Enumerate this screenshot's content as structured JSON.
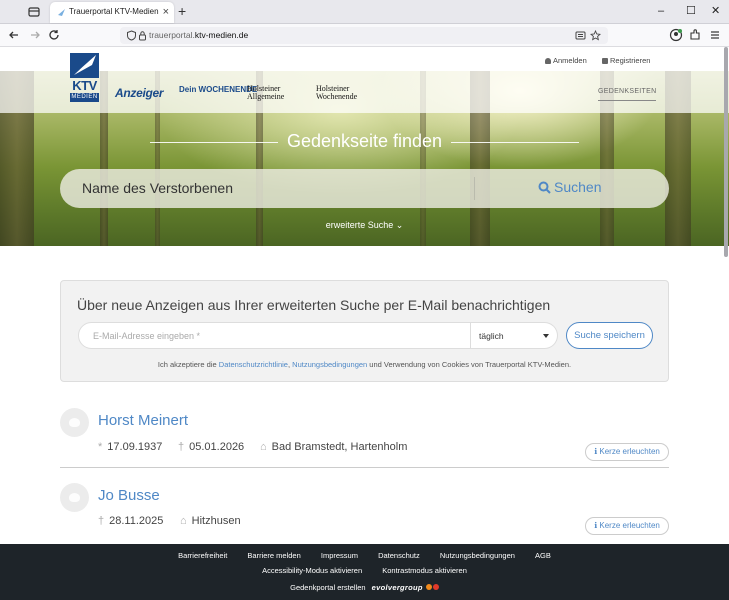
{
  "browser": {
    "tab_title": "Trauerportal KTV-Medien",
    "url_prefix": "trauerportal.",
    "url_domain": "ktv-medien.de"
  },
  "header": {
    "login": "Anmelden",
    "register": "Registrieren",
    "nav_gedenkseiten": "GEDENKSEITEN",
    "logo": {
      "letters": "KTV",
      "sub": "MEDIEN"
    },
    "papers": [
      "Anzeiger",
      "Dein WOCHENENDE",
      "Holsteiner Allgemeine",
      "Holsteiner Wochenende"
    ]
  },
  "hero": {
    "title": "Gedenkseite finden",
    "search_placeholder": "Name des Verstorbenen",
    "search_button": "Suchen",
    "advanced": "erweiterte Suche"
  },
  "notify": {
    "title": "Über neue Anzeigen aus Ihrer erweiterten Suche per E-Mail benachrichtigen",
    "email_placeholder": "E-Mail-Adresse eingeben *",
    "frequency": "täglich",
    "save": "Suche speichern",
    "consent_pre": "Ich akzeptiere die ",
    "privacy": "Datenschutzrichtlinie",
    "comma": ", ",
    "terms": "Nutzungsbedingungen",
    "consent_post": " und Verwendung von Cookies von Trauerportal KTV-Medien."
  },
  "results": [
    {
      "name": "Horst Meinert",
      "born": "17.09.1937",
      "died": "05.01.2026",
      "place": "Bad Bramstedt, Hartenholm",
      "candle": "Kerze erleuchten"
    },
    {
      "name": "Jo Busse",
      "died": "28.11.2025",
      "place": "Hitzhusen",
      "candle": "Kerze erleuchten"
    }
  ],
  "footer": {
    "links": [
      "Barrierefreiheit",
      "Barriere melden",
      "Impressum",
      "Datenschutz",
      "Nutzungsbedingungen",
      "AGB"
    ],
    "links2": [
      "Accessibility-Modus aktivieren",
      "Kontrastmodus aktivieren"
    ],
    "created": "Gedenkportal erstellen",
    "brand": "evolvergroup"
  },
  "colors": {
    "accent": "#4f88c6",
    "ktv_blue": "#1a4a8a",
    "footer": "#1e2429"
  },
  "icons": [
    "tab-list-icon",
    "back-icon",
    "forward-icon",
    "reload-icon",
    "shield-icon",
    "lock-icon",
    "reader-icon",
    "star-icon",
    "account-icon",
    "extensions-icon",
    "menu-icon",
    "search-icon",
    "person-icon",
    "check-icon",
    "star-birth-icon",
    "cross-icon",
    "home-icon",
    "candle-icon"
  ]
}
